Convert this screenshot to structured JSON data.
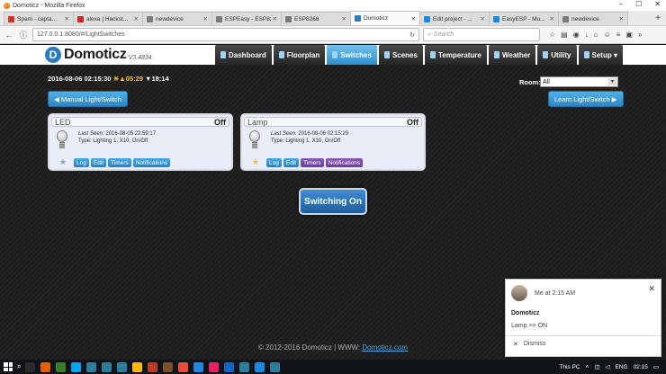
{
  "browser": {
    "title": "Domoticz - Mozilla Firefox",
    "window_buttons": [
      "–",
      "☐",
      "✕"
    ],
    "tabs": [
      {
        "label": "Spam - capta...",
        "color": "#d93025",
        "active": false
      },
      {
        "label": "alexa | Hackst...",
        "color": "#c62828",
        "active": false
      },
      {
        "label": "newdevice",
        "color": "#7a7a7a",
        "active": false
      },
      {
        "label": "ESPEasy - ESP8266",
        "color": "#7a7a7a",
        "active": false
      },
      {
        "label": "ESP8266",
        "color": "#7a7a7a",
        "active": false
      },
      {
        "label": "Domoticz",
        "color": "#2a7bc0",
        "active": true
      },
      {
        "label": "Edit project - ...",
        "color": "#1e88e5",
        "active": false
      },
      {
        "label": "EasyESP - Mu...",
        "color": "#1e88e5",
        "active": false
      },
      {
        "label": "newdevice",
        "color": "#7a7a7a",
        "active": false
      }
    ],
    "url": "127.0.0.1:8080/#/LightSwitches",
    "search_placeholder": "Search"
  },
  "header": {
    "logo_text": "Domoticz",
    "version": "V3.4834",
    "menu": [
      {
        "label": "Dashboard",
        "active": false
      },
      {
        "label": "Floorplan",
        "active": false
      },
      {
        "label": "Switches",
        "active": true
      },
      {
        "label": "Scenes",
        "active": false
      },
      {
        "label": "Temperature",
        "active": false
      },
      {
        "label": "Weather",
        "active": false
      },
      {
        "label": "Utility",
        "active": false
      },
      {
        "label": "Setup ▾",
        "active": false
      }
    ]
  },
  "status": {
    "datetime": "2016-08-06 02:15:30",
    "sunrise": "☀▲05:29",
    "sunset": "▼18:14"
  },
  "room": {
    "label": "Room:",
    "selected": "All"
  },
  "buttons": {
    "manual": "◀ Manual Light/Switch",
    "learn": "Learn Light/Switch ▶"
  },
  "devices": [
    {
      "name": "LED",
      "state": "Off",
      "last_seen_label": "Last Seen:",
      "last_seen": "2016-08-05 22:59:17",
      "type": "Type: Lighting 1, X10, On/Off",
      "star": "★",
      "star_color": "#7aa6c9",
      "actions": [
        "Log",
        "Edit",
        "Timers",
        "Notifications"
      ],
      "timers_color": "blue",
      "notif_color": "blue"
    },
    {
      "name": "Lamp",
      "state": "Off",
      "last_seen_label": "Last Seen:",
      "last_seen": "2016-08-06 02:15:29",
      "type": "Type: Lighting 1, X10, On/Off",
      "star": "★",
      "star_color": "#f5c518",
      "actions": [
        "Log",
        "Edit",
        "Timers",
        "Notifications"
      ],
      "timers_color": "purple",
      "notif_color": "purple"
    }
  ],
  "switching_message": "Switching On",
  "footer": {
    "text": "© 2012-2016 Domoticz | WWW:",
    "link": "Domoticz.com"
  },
  "notification": {
    "sender": "Me at 2:15 AM",
    "title": "Domoticz",
    "message": "Lamp >> ON",
    "dismiss": "Dismiss"
  },
  "taskbar": {
    "app_colors": [
      "#2b2b2b",
      "#e66000",
      "#3a7d2a",
      "#00a4ef",
      "#2d7d9a",
      "#2d7d9a",
      "#2d7d9a",
      "#ffb900",
      "#c0392b",
      "#7b4f2c",
      "#e74c3c",
      "#1e88e5",
      "#e91e63",
      "#1565c0",
      "#2d7d9a",
      "#1e88e5",
      "#2d7d9a"
    ],
    "tray_label": "This PC",
    "lang": "ENG",
    "time": "02:15"
  }
}
